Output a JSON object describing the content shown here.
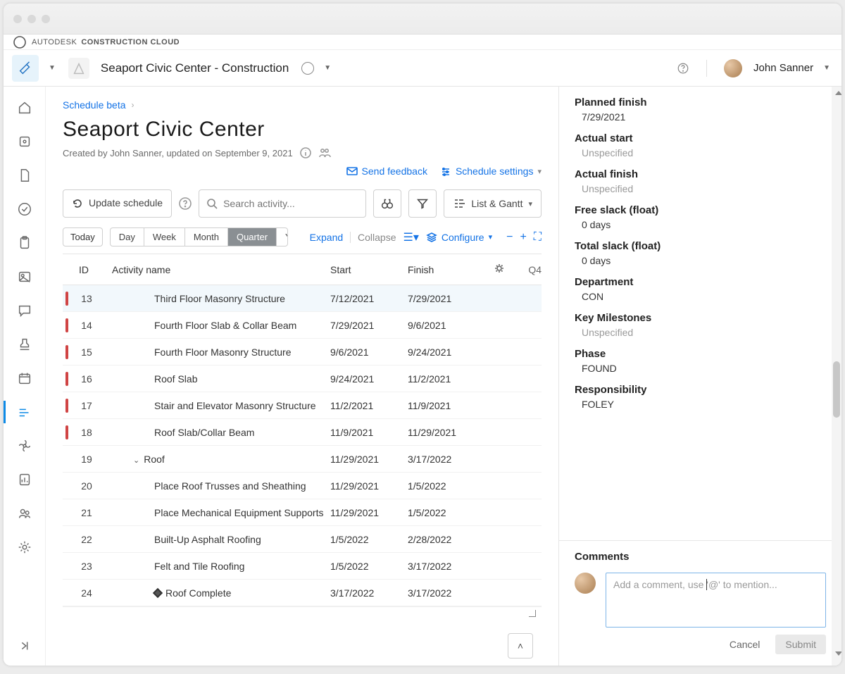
{
  "brand": {
    "a": "AUTODESK",
    "b": "CONSTRUCTION CLOUD"
  },
  "header": {
    "project": "Seaport Civic Center - Construction",
    "user": "John Sanner"
  },
  "page": {
    "breadcrumb": "Schedule beta",
    "title": "Seaport Civic Center",
    "meta": "Created by John Sanner, updated on September 9, 2021",
    "send_feedback": "Send feedback",
    "settings": "Schedule settings",
    "update": "Update schedule",
    "search_ph": "Search activity...",
    "viewmode": "List & Gantt",
    "today": "Today",
    "ranges": [
      "Day",
      "Week",
      "Month",
      "Quarter",
      "Year"
    ],
    "range_active": "Quarter",
    "expand": "Expand",
    "collapse": "Collapse",
    "configure": "Configure",
    "q4": "Q4"
  },
  "cols": {
    "id": "ID",
    "name": "Activity name",
    "start": "Start",
    "finish": "Finish"
  },
  "rows": [
    {
      "id": "13",
      "name": "Third Floor Masonry Structure",
      "start": "7/12/2021",
      "finish": "7/29/2021",
      "red": true,
      "sel": true
    },
    {
      "id": "14",
      "name": "Fourth Floor Slab & Collar Beam",
      "start": "7/29/2021",
      "finish": "9/6/2021",
      "red": true
    },
    {
      "id": "15",
      "name": "Fourth Floor Masonry Structure",
      "start": "9/6/2021",
      "finish": "9/24/2021",
      "red": true
    },
    {
      "id": "16",
      "name": "Roof Slab",
      "start": "9/24/2021",
      "finish": "11/2/2021",
      "red": true
    },
    {
      "id": "17",
      "name": "Stair and Elevator Masonry Structure",
      "start": "11/2/2021",
      "finish": "11/9/2021",
      "red": true
    },
    {
      "id": "18",
      "name": "Roof Slab/Collar Beam",
      "start": "11/9/2021",
      "finish": "11/29/2021",
      "red": true
    },
    {
      "id": "19",
      "name": "Roof",
      "start": "11/29/2021",
      "finish": "3/17/2022",
      "grp": true
    },
    {
      "id": "20",
      "name": "Place Roof Trusses and Sheathing",
      "start": "11/29/2021",
      "finish": "1/5/2022"
    },
    {
      "id": "21",
      "name": "Place Mechanical Equipment Supports",
      "start": "11/29/2021",
      "finish": "1/5/2022"
    },
    {
      "id": "22",
      "name": "Built-Up Asphalt Roofing",
      "start": "1/5/2022",
      "finish": "2/28/2022"
    },
    {
      "id": "23",
      "name": "Felt and Tile Roofing",
      "start": "1/5/2022",
      "finish": "3/17/2022"
    },
    {
      "id": "24",
      "name": "Roof Complete",
      "start": "3/17/2022",
      "finish": "3/17/2022",
      "milestone": true
    }
  ],
  "details": [
    {
      "label": "Planned finish",
      "value": "7/29/2021"
    },
    {
      "label": "Actual start",
      "value": "Unspecified",
      "un": true
    },
    {
      "label": "Actual finish",
      "value": "Unspecified",
      "un": true
    },
    {
      "label": "Free slack (float)",
      "value": "0 days"
    },
    {
      "label": "Total slack (float)",
      "value": "0 days"
    },
    {
      "label": "Department",
      "value": "CON"
    },
    {
      "label": "Key Milestones",
      "value": "Unspecified",
      "un": true
    },
    {
      "label": "Phase",
      "value": "FOUND"
    },
    {
      "label": "Responsibility",
      "value": "FOLEY"
    }
  ],
  "comments": {
    "title": "Comments",
    "placeholder": "Add a comment, use '@' to mention...",
    "cancel": "Cancel",
    "submit": "Submit"
  }
}
